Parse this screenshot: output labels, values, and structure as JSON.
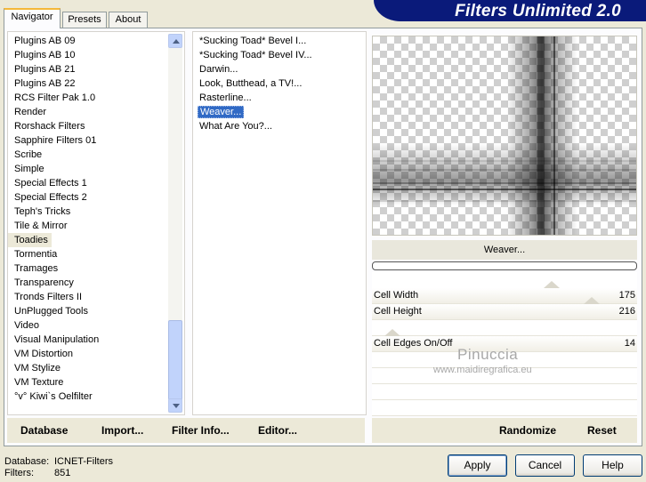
{
  "banner": {
    "title": "Filters Unlimited 2.0"
  },
  "tabs": [
    {
      "label": "Navigator",
      "active": true
    },
    {
      "label": "Presets",
      "active": false
    },
    {
      "label": "About",
      "active": false
    }
  ],
  "categories": [
    "Plugins AB 09",
    "Plugins AB 10",
    "Plugins AB 21",
    "Plugins AB 22",
    "RCS Filter Pak 1.0",
    "Render",
    "Rorshack Filters",
    "Sapphire Filters 01",
    "Scribe",
    "Simple",
    "Special Effects 1",
    "Special Effects 2",
    "Teph's Tricks",
    "Tile & Mirror",
    "Toadies",
    "Tormentia",
    "Tramages",
    "Transparency",
    "Tronds Filters II",
    "UnPlugged Tools",
    "Video",
    "Visual Manipulation",
    "VM Distortion",
    "VM Stylize",
    "VM Texture",
    "°v° Kiwi`s Oelfilter"
  ],
  "selected_category": "Toadies",
  "filters": [
    "*Sucking Toad*  Bevel I...",
    "*Sucking Toad*  Bevel IV...",
    "Darwin...",
    "Look, Butthead, a TV!...",
    "Rasterline...",
    "Weaver...",
    "What Are You?..."
  ],
  "selected_filter": "Weaver...",
  "preview": {
    "filter_name": "Weaver..."
  },
  "params": [
    {
      "label": "Cell Width",
      "value": "175",
      "slider_fraction": 0.69
    },
    {
      "label": "Cell Height",
      "value": "216",
      "slider_fraction": 0.85
    },
    {
      "label": "",
      "value": ""
    },
    {
      "label": "Cell Edges On/Off",
      "value": "14",
      "slider_fraction": 0.05
    },
    {
      "label": "",
      "value": ""
    },
    {
      "label": "",
      "value": ""
    },
    {
      "label": "",
      "value": ""
    },
    {
      "label": "",
      "value": ""
    }
  ],
  "watermark": {
    "name": "Pinuccia",
    "url": "www.maidiregrafica.eu"
  },
  "links": {
    "database": "Database",
    "import": "Import...",
    "filter_info": "Filter Info...",
    "editor": "Editor...",
    "randomize": "Randomize",
    "reset": "Reset"
  },
  "info": {
    "database_label": "Database:",
    "database_value": "ICNET-Filters",
    "filters_label": "Filters:",
    "filters_value": "851"
  },
  "buttons": {
    "apply": "Apply",
    "cancel": "Cancel",
    "help": "Help"
  }
}
